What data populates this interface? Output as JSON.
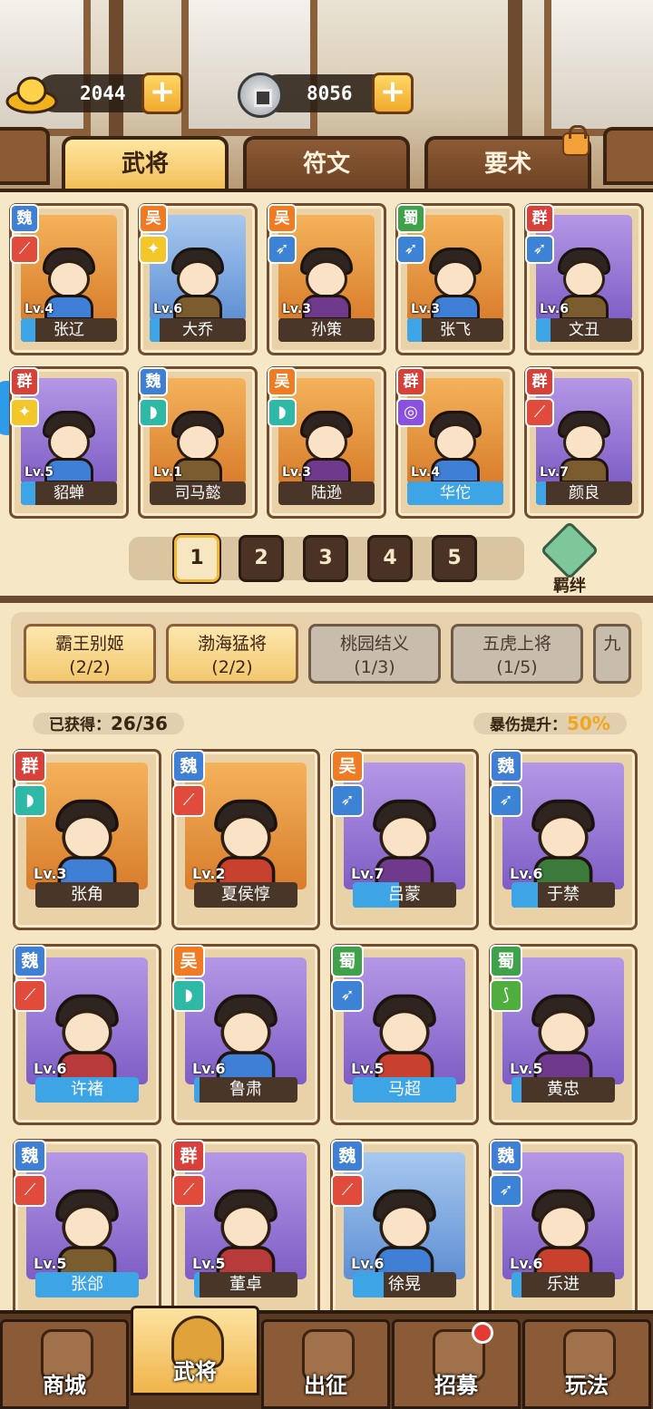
{
  "resources": {
    "gold": "2044",
    "coin": "8056",
    "plus": "+"
  },
  "tabs": [
    {
      "label": "武将",
      "active": true
    },
    {
      "label": "符文",
      "active": false
    },
    {
      "label": "要术",
      "active": false
    }
  ],
  "heroes_top": [
    {
      "faction": "魏",
      "fclass": "f-wei",
      "wclass": "w-red",
      "weapon": "blade-icon",
      "lv": "Lv.4",
      "name": "张辽",
      "bg": "p-orange",
      "progress": 0.15
    },
    {
      "faction": "吴",
      "fclass": "f-wu",
      "wclass": "w-yellow",
      "weapon": "sword-icon",
      "lv": "Lv.6",
      "name": "大乔",
      "bg": "p-blue",
      "progress": 0.1
    },
    {
      "faction": "吴",
      "fclass": "f-wu",
      "wclass": "w-blue",
      "weapon": "spear-icon",
      "lv": "Lv.3",
      "name": "孙策",
      "bg": "p-orange",
      "progress": 0.0
    },
    {
      "faction": "蜀",
      "fclass": "f-shu",
      "wclass": "w-blue",
      "weapon": "spear-icon",
      "lv": "Lv.3",
      "name": "张飞",
      "bg": "p-orange",
      "progress": 0.15
    },
    {
      "faction": "群",
      "fclass": "f-qun",
      "wclass": "w-blue",
      "weapon": "spear-icon",
      "lv": "Lv.6",
      "name": "文丑",
      "bg": "p-purple",
      "progress": 0.15
    },
    {
      "faction": "群",
      "fclass": "f-qun",
      "wclass": "w-yellow",
      "weapon": "sword-icon",
      "lv": "Lv.5",
      "name": "貂蝉",
      "bg": "p-purple",
      "progress": 0.15
    },
    {
      "faction": "魏",
      "fclass": "f-wei",
      "wclass": "w-teal",
      "weapon": "fan-icon",
      "lv": "Lv.1",
      "name": "司马懿",
      "bg": "p-orange",
      "progress": 0.0
    },
    {
      "faction": "吴",
      "fclass": "f-wu",
      "wclass": "w-teal",
      "weapon": "fan-icon",
      "lv": "Lv.3",
      "name": "陆逊",
      "bg": "p-orange",
      "progress": 0.0
    },
    {
      "faction": "群",
      "fclass": "f-qun",
      "wclass": "w-purple",
      "weapon": "swirl-icon",
      "lv": "Lv.4",
      "name": "华佗",
      "bg": "p-orange",
      "progress": 1.0
    },
    {
      "faction": "群",
      "fclass": "f-qun",
      "wclass": "w-red",
      "weapon": "blade-icon",
      "lv": "Lv.7",
      "name": "颜良",
      "bg": "p-purple",
      "progress": 0.1
    }
  ],
  "pages": [
    "1",
    "2",
    "3",
    "4",
    "5"
  ],
  "bond_label": "羁绊",
  "bond_chips": [
    {
      "title": "霸王别姬",
      "count": "(2/2)",
      "state": "on"
    },
    {
      "title": "渤海猛将",
      "count": "(2/2)",
      "state": "on"
    },
    {
      "title": "桃园结义",
      "count": "(1/3)",
      "state": "dim"
    },
    {
      "title": "五虎上将",
      "count": "(1/5)",
      "state": "dim"
    },
    {
      "title": "九",
      "count": "",
      "state": "dim"
    }
  ],
  "stats": {
    "owned_label": "已获得：",
    "owned_value": "26/36",
    "crit_label": "暴伤提升：",
    "crit_value": "50%"
  },
  "heroes_bond": [
    {
      "faction": "群",
      "fclass": "f-qun",
      "wclass": "w-teal",
      "weapon": "fan-icon",
      "lv": "Lv.3",
      "name": "张角",
      "bg": "p-orange",
      "progress": 0.0
    },
    {
      "faction": "魏",
      "fclass": "f-wei",
      "wclass": "w-red",
      "weapon": "blade-icon",
      "lv": "Lv.2",
      "name": "夏侯惇",
      "bg": "p-orange",
      "progress": 0.0
    },
    {
      "faction": "吴",
      "fclass": "f-wu",
      "wclass": "w-blue",
      "weapon": "spear-icon",
      "lv": "Lv.7",
      "name": "吕蒙",
      "bg": "p-purple",
      "progress": 0.45
    },
    {
      "faction": "魏",
      "fclass": "f-wei",
      "wclass": "w-blue",
      "weapon": "spear-icon",
      "lv": "Lv.6",
      "name": "于禁",
      "bg": "p-purple",
      "progress": 0.25
    },
    {
      "faction": "魏",
      "fclass": "f-wei",
      "wclass": "w-red",
      "weapon": "blade-icon",
      "lv": "Lv.6",
      "name": "许褚",
      "bg": "p-purple",
      "progress": 1.0
    },
    {
      "faction": "吴",
      "fclass": "f-wu",
      "wclass": "w-teal",
      "weapon": "fan-icon",
      "lv": "Lv.6",
      "name": "鲁肃",
      "bg": "p-purple",
      "progress": 0.05
    },
    {
      "faction": "蜀",
      "fclass": "f-shu",
      "wclass": "w-blue",
      "weapon": "spear-icon",
      "lv": "Lv.5",
      "name": "马超",
      "bg": "p-purple",
      "progress": 1.0
    },
    {
      "faction": "蜀",
      "fclass": "f-shu",
      "wclass": "w-green",
      "weapon": "bow-icon",
      "lv": "Lv.5",
      "name": "黄忠",
      "bg": "p-purple",
      "progress": 0.1
    },
    {
      "faction": "魏",
      "fclass": "f-wei",
      "wclass": "w-red",
      "weapon": "blade-icon",
      "lv": "Lv.5",
      "name": "张郃",
      "bg": "p-purple",
      "progress": 1.0
    },
    {
      "faction": "群",
      "fclass": "f-qun",
      "wclass": "w-red",
      "weapon": "blade-icon",
      "lv": "Lv.5",
      "name": "董卓",
      "bg": "p-purple",
      "progress": 0.05
    },
    {
      "faction": "魏",
      "fclass": "f-wei",
      "wclass": "w-red",
      "weapon": "blade-icon",
      "lv": "Lv.6",
      "name": "徐晃",
      "bg": "p-blue",
      "progress": 0.3
    },
    {
      "faction": "魏",
      "fclass": "f-wei",
      "wclass": "w-blue",
      "weapon": "spear-icon",
      "lv": "Lv.6",
      "name": "乐进",
      "bg": "p-purple",
      "progress": 0.1
    }
  ],
  "nav": [
    {
      "label": "商城",
      "icon": "shop-icon",
      "active": false
    },
    {
      "label": "武将",
      "icon": "helmet-icon",
      "active": true
    },
    {
      "label": "出征",
      "icon": "battle-icon",
      "active": false
    },
    {
      "label": "招募",
      "icon": "scroll-icon",
      "active": false
    },
    {
      "label": "玩法",
      "icon": "pavilion-icon",
      "active": false
    }
  ]
}
